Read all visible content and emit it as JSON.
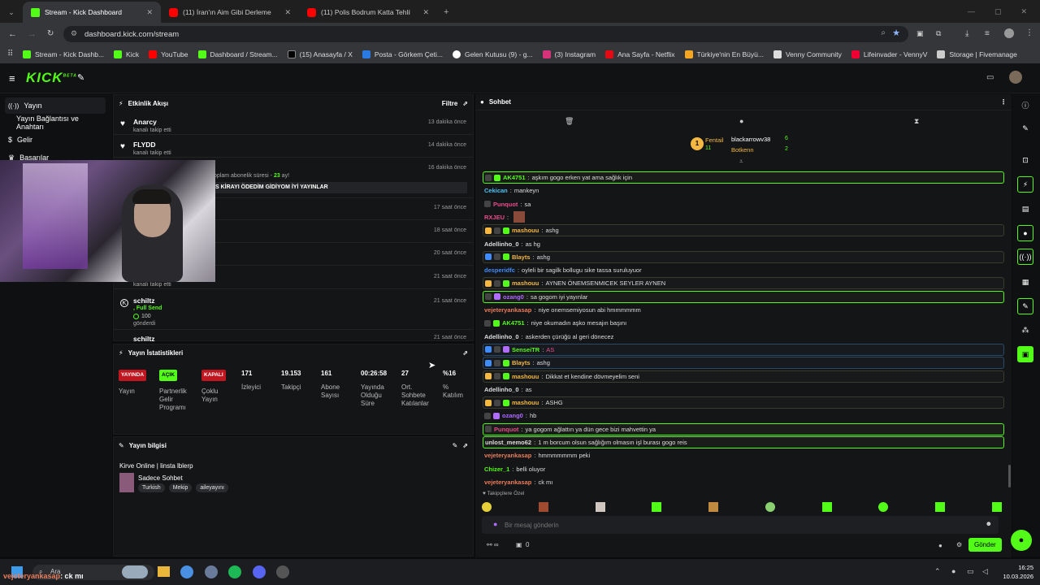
{
  "browser": {
    "tabs": [
      {
        "title": "Stream - Kick Dashboard",
        "icon": "kick-icon"
      },
      {
        "title": "(11) İran'ın Aim Gibi Derleme | ",
        "icon": "youtube-icon"
      },
      {
        "title": "(11) Polis Bodrum Katta Tehlike",
        "icon": "youtube-icon"
      }
    ],
    "url": "dashboard.kick.com/stream",
    "bookmarks": [
      "Stream - Kick Dashb...",
      "Kick",
      "YouTube",
      "Dashboard / Stream...",
      "(15) Anasayfa / X",
      "Posta - Görkem Çeti...",
      "Gelen Kutusu (9) - g...",
      "(3) Instagram",
      "Ana Sayfa - Netflix",
      "Türkiye'nin En Büyü...",
      "Venny Community",
      "Lifeinvader - VennyV",
      "Storage | Fivemanage"
    ]
  },
  "app": {
    "logo": "KICK",
    "logo_sup": "BETA"
  },
  "nav": {
    "items": [
      "Yayın",
      "Yayın Bağlantısı ve Anahtarı",
      "Gelir",
      "Başarılar"
    ]
  },
  "activity": {
    "title": "Etkinlik Akışı",
    "filter": "Filtre",
    "items": [
      {
        "user": "Anarcy",
        "sub": "kanalı takip etti",
        "time": "13 dakika önce"
      },
      {
        "user": "FLYDD",
        "sub": "kanalı takip etti",
        "time": "14 dakika önce"
      },
      {
        "time": "16 dakika önce"
      },
      {
        "time": "17 saat önce"
      },
      {
        "time": "18 saat önce"
      },
      {
        "time": "20 saat önce"
      },
      {
        "sub": "kanalı takip etti",
        "time": "21 saat önce"
      },
      {
        "user": "schiltz",
        "time": "21 saat önce"
      },
      {
        "user": "schiltz",
        "time": "21 saat önce"
      }
    ],
    "sub_text": "oplam abonelik süresi - ",
    "sub_months": "23",
    "sub_months_suffix": " ay!",
    "sub_message": "S KİRAYI ÖDEDİM GİDİYOM İYİ YAYINLAR",
    "gift_label": ", Full Send",
    "gift_amount": "100",
    "gift_sub": "gönderdi"
  },
  "stats": {
    "title": "Yayın İstatistikleri",
    "items": [
      {
        "badge": "YAYINDA",
        "label": "Yayın"
      },
      {
        "badge": "AÇIK",
        "label": "Partnerlik Gelir Programı"
      },
      {
        "badge": "KAPALI",
        "label": "Çoklu Yayın"
      },
      {
        "value": "171",
        "label": "İzleyici"
      },
      {
        "value": "19.153",
        "label": "Takipçi"
      },
      {
        "value": "161",
        "label": "Abone Sayısı"
      },
      {
        "value": "00:26:58",
        "label": "Yayında Olduğu Süre"
      },
      {
        "value": "27",
        "label": "Ort. Sohbete Katılanlar"
      },
      {
        "value": "%16",
        "label": "% Katılım"
      }
    ]
  },
  "info": {
    "title": "Yayın bilgisi",
    "stream_title": "Kirve Online | linsta lblerp",
    "category": "Sadece Sohbet",
    "tags": [
      "Turkish",
      "Mekip",
      "aileyayını"
    ]
  },
  "chat": {
    "title": "Sohbet",
    "top_gifters": [
      {
        "name": "Fentail",
        "count": "11",
        "rank": "1"
      },
      {
        "name": "blackarrowv38",
        "count": "6"
      },
      {
        "name": "Botkenn",
        "count": "2"
      }
    ],
    "messages": [
      {
        "user": "AK4751",
        "text": "aşkım gogo erken yat ama sağlık için",
        "color": "#53fc18",
        "style": "hl",
        "badges": [
          "s",
          "g"
        ]
      },
      {
        "user": "Cekican",
        "text": "mankeyn",
        "color": "#4fc3f7",
        "style": "",
        "badges": []
      },
      {
        "user": "Punquot",
        "text": "sa",
        "color": "#e84b8a",
        "style": "",
        "badges": [
          "s"
        ]
      },
      {
        "user": "RXJEU",
        "text": "",
        "color": "#e84b8a",
        "style": "",
        "badges": []
      },
      {
        "user": "mashouu",
        "text": "ashg",
        "color": "#f5b942",
        "style": "hy",
        "badges": [
          "c",
          "s",
          "g"
        ]
      },
      {
        "user": "Adellinho_0",
        "text": "as hg",
        "color": "#ddd",
        "style": "",
        "badges": []
      },
      {
        "user": "Blayts",
        "text": "ashg",
        "color": "#f5b942",
        "style": "hy",
        "badges": [
          "v",
          "s",
          "g"
        ]
      },
      {
        "user": "desperidfc",
        "text": "oyleli bir sagilk bollugu sike tassa suruluyuor",
        "color": "#3f8cff",
        "style": "",
        "badges": []
      },
      {
        "user": "mashouu",
        "text": "AYNEN ÖNEMSENMICEK SEYLER AYNEN",
        "color": "#f5b942",
        "style": "hy",
        "badges": [
          "c",
          "s",
          "g"
        ]
      },
      {
        "user": "ozang0",
        "text": "sa gogom iyi yayınlar",
        "color": "#b06bff",
        "style": "hl",
        "badges": [
          "s",
          "p"
        ]
      },
      {
        "user": "vejeteryankasap",
        "text": "niye onemsemiyosun abi hmmmmmm",
        "color": "#e87d5b",
        "style": "",
        "badges": []
      },
      {
        "user": "AK4751",
        "text": "niye okumadın aşko mesajın başını",
        "color": "#53fc18",
        "style": "",
        "badges": [
          "s",
          "g"
        ]
      },
      {
        "user": "Adellinho_0",
        "text": "askerden çürüğü al geri dönecez",
        "color": "#ddd",
        "style": "",
        "badges": []
      },
      {
        "user": "SenseiTR",
        "text": "AS",
        "color": "#53fc18",
        "style": "hb",
        "badges": [
          "v",
          "s",
          "p"
        ]
      },
      {
        "user": "Blayts",
        "text": "ashg",
        "color": "#f5b942",
        "style": "hb",
        "badges": [
          "v",
          "s",
          "g"
        ]
      },
      {
        "user": "mashouu",
        "text": "Dikkat et kendine dövmeyelim seni",
        "color": "#f5b942",
        "style": "hy",
        "badges": [
          "c",
          "s",
          "g"
        ]
      },
      {
        "user": "Adellinho_0",
        "text": "as",
        "color": "#ddd",
        "style": "",
        "badges": []
      },
      {
        "user": "mashouu",
        "text": "ASHG",
        "color": "#f5b942",
        "style": "hy",
        "badges": [
          "c",
          "s",
          "g"
        ]
      },
      {
        "user": "ozang0",
        "text": "hb",
        "color": "#b06bff",
        "style": "",
        "badges": [
          "s",
          "p"
        ]
      },
      {
        "user": "Punquot",
        "text": "ya gogom ağlattın ya dün gece bizi mahvettin ya",
        "color": "#e84b8a",
        "style": "hl",
        "badges": [
          "s"
        ]
      },
      {
        "user": "unlost_memo62",
        "text": "1 m borcum olsun sağlığım olmasın işl burası gogo reis",
        "color": "#ddd",
        "style": "hl",
        "badges": []
      },
      {
        "user": "vejeteryankasap",
        "text": "hmmmmmmm peki",
        "color": "#e87d5b",
        "style": "",
        "badges": []
      },
      {
        "user": "Chizer_1",
        "text": "belli oluyor",
        "color": "#53fc18",
        "style": "",
        "badges": []
      },
      {
        "user": "vejeteryankasap",
        "text": "ck mı",
        "color": "#e87d5b",
        "style": "",
        "badges": []
      }
    ],
    "followers_only": "Takipçilere Özel",
    "input_placeholder": "Bir mesaj gönderin",
    "send_button": "Gönder",
    "bottom_count": "0"
  },
  "taskbar": {
    "search": "Ara",
    "overlay_user": "vejeteryankasap",
    "overlay_text": ": ck mı",
    "time": "16:25",
    "date": "10.03.2026"
  }
}
